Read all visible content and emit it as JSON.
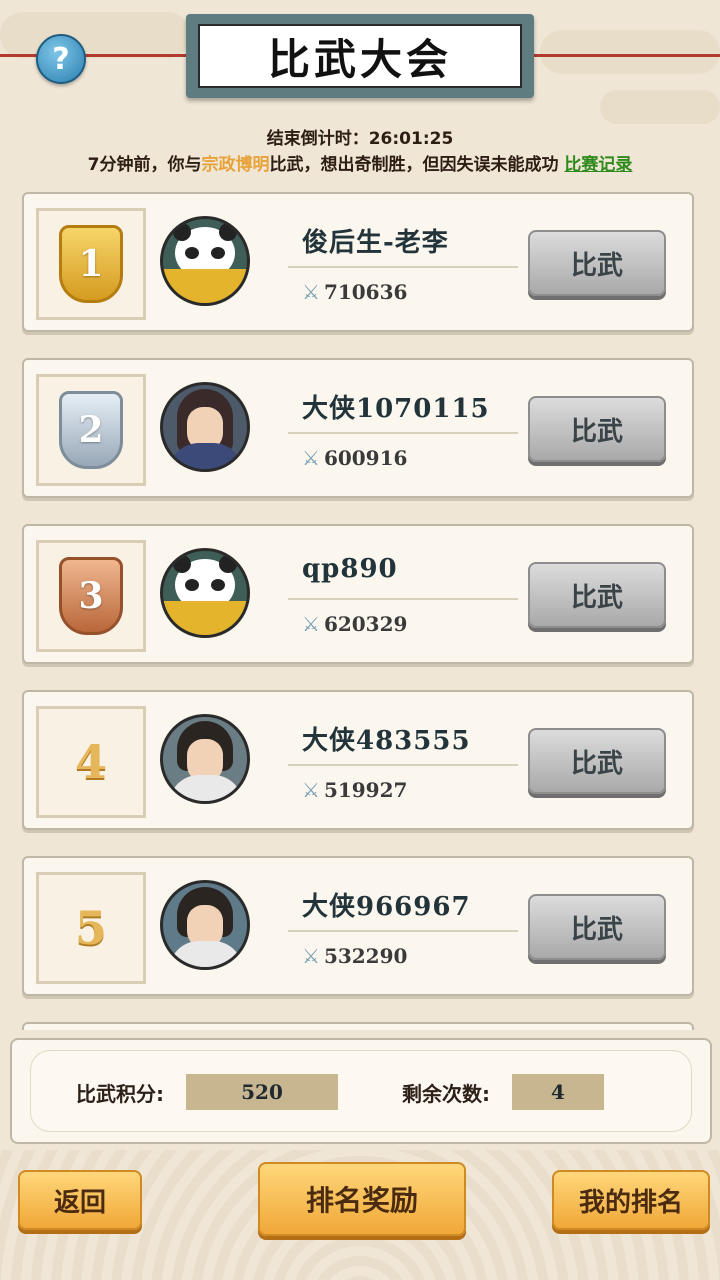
{
  "header": {
    "title": "比武大会",
    "help_icon": "help-icon",
    "countdown_label": "结束倒计时：",
    "countdown_value": "26:01:25"
  },
  "battle_log": {
    "prefix": "7分钟前，你与",
    "opponent": "宗政博明",
    "suffix": "比武，想出奇制胜，但因失误未能成功",
    "record_link": "比赛记录"
  },
  "players": [
    {
      "rank": "1",
      "medal": "gold",
      "name": "俊后生-老李",
      "power": "710636",
      "action": "比武",
      "avatar": "panda"
    },
    {
      "rank": "2",
      "medal": "silver",
      "name": "大侠1070115",
      "power": "600916",
      "action": "比武",
      "avatar": "female-warrior"
    },
    {
      "rank": "3",
      "medal": "bronze",
      "name": "qp890",
      "power": "620329",
      "action": "比武",
      "avatar": "panda"
    },
    {
      "rank": "4",
      "medal": "none",
      "name": "大侠483555",
      "power": "519927",
      "action": "比武",
      "avatar": "male-warrior"
    },
    {
      "rank": "5",
      "medal": "none",
      "name": "大侠966967",
      "power": "532290",
      "action": "比武",
      "avatar": "male-warrior"
    }
  ],
  "score": {
    "points_label": "比武积分:",
    "points_value": "520",
    "remaining_label": "剩余次数:",
    "remaining_value": "4"
  },
  "footer": {
    "back": "返回",
    "rewards": "排名奖励",
    "my_rank": "我的排名"
  },
  "colors": {
    "accent_orange": "#f0a838",
    "opponent_highlight": "#e8a23a",
    "record_link": "#2f8a1c"
  }
}
